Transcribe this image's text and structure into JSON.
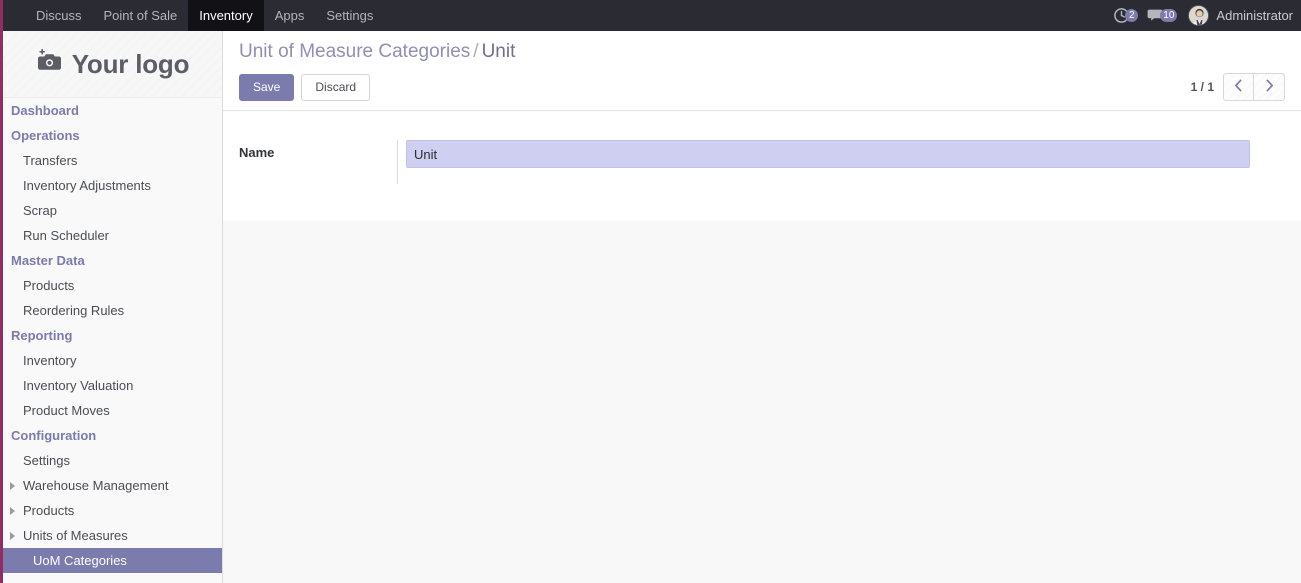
{
  "navbar": {
    "menu_items": [
      {
        "label": "Discuss",
        "active": false
      },
      {
        "label": "Point of Sale",
        "active": false
      },
      {
        "label": "Inventory",
        "active": true
      },
      {
        "label": "Apps",
        "active": false
      },
      {
        "label": "Settings",
        "active": false
      }
    ],
    "activities": {
      "icon": "clock-icon",
      "count": "2"
    },
    "messages": {
      "icon": "chat-bubble-icon",
      "count": "10"
    },
    "user": {
      "name": "Administrator",
      "avatar": "user-avatar"
    }
  },
  "sidebar": {
    "logo": {
      "text": "Your logo",
      "icon": "camera-add-icon"
    },
    "groups": [
      {
        "title": "Dashboard",
        "is_standalone": true,
        "items": []
      },
      {
        "title": "Operations",
        "items": [
          {
            "label": "Transfers",
            "caret": false,
            "active": false
          },
          {
            "label": "Inventory Adjustments",
            "caret": false,
            "active": false
          },
          {
            "label": "Scrap",
            "caret": false,
            "active": false
          },
          {
            "label": "Run Scheduler",
            "caret": false,
            "active": false
          }
        ]
      },
      {
        "title": "Master Data",
        "items": [
          {
            "label": "Products",
            "caret": false,
            "active": false
          },
          {
            "label": "Reordering Rules",
            "caret": false,
            "active": false
          }
        ]
      },
      {
        "title": "Reporting",
        "items": [
          {
            "label": "Inventory",
            "caret": false,
            "active": false
          },
          {
            "label": "Inventory Valuation",
            "caret": false,
            "active": false
          },
          {
            "label": "Product Moves",
            "caret": false,
            "active": false
          }
        ]
      },
      {
        "title": "Configuration",
        "items": [
          {
            "label": "Settings",
            "caret": false,
            "active": false
          },
          {
            "label": "Warehouse Management",
            "caret": true,
            "active": false
          },
          {
            "label": "Products",
            "caret": true,
            "active": false
          },
          {
            "label": "Units of Measures",
            "caret": true,
            "active": false
          },
          {
            "label": "UoM Categories",
            "caret": false,
            "active": true
          }
        ]
      }
    ]
  },
  "control_panel": {
    "breadcrumb": {
      "parent": "Unit of Measure Categories",
      "separator": "/",
      "current": "Unit"
    },
    "save_label": "Save",
    "discard_label": "Discard",
    "pager": {
      "count": "1 / 1",
      "prev_icon": "chevron-left-icon",
      "next_icon": "chevron-right-icon"
    }
  },
  "form": {
    "fields": [
      {
        "label": "Name",
        "value": "Unit",
        "placeholder": ""
      }
    ]
  },
  "colors": {
    "brand_purple": "#7c7bad",
    "navbar_bg": "#2b2b33",
    "accent_border": "#8e2f63",
    "field_focus_bg": "#cfcff2"
  }
}
